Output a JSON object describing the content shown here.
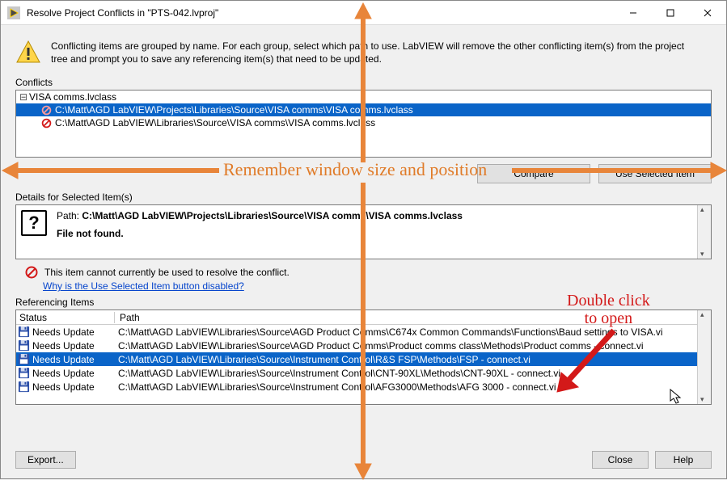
{
  "window": {
    "title": "Resolve Project Conflicts in \"PTS-042.lvproj\""
  },
  "info_text": "Conflicting items are grouped by name.  For each group, select which path to use.  LabVIEW will remove the other conflicting item(s) from the project tree and prompt you to save any referencing item(s) that need to be updated.",
  "labels": {
    "conflicts": "Conflicts",
    "details": "Details for Selected Item(s)",
    "referencing": "Referencing Items",
    "status_col": "Status",
    "path_col": "Path"
  },
  "conflicts_tree": {
    "group": "VISA comms.lvclass",
    "items": [
      {
        "path": "C:\\Matt\\AGD LabVIEW\\Projects\\Libraries\\Source\\VISA comms\\VISA comms.lvclass",
        "selected": true
      },
      {
        "path": "C:\\Matt\\AGD LabVIEW\\Libraries\\Source\\VISA comms\\VISA comms.lvclass",
        "selected": false
      }
    ]
  },
  "buttons": {
    "compare": "Compare",
    "use_selected": "Use Selected Item",
    "export": "Export...",
    "close": "Close",
    "help": "Help"
  },
  "details": {
    "path_label": "Path:",
    "path_value": "C:\\Matt\\AGD LabVIEW\\Projects\\Libraries\\Source\\VISA comms\\VISA comms.lvclass",
    "status": "File not found.",
    "cannot_text": "This item cannot currently be used to resolve the conflict.",
    "link_text": "Why is the Use Selected Item button disabled?"
  },
  "referencing_items": [
    {
      "status": "Needs Update",
      "path": "C:\\Matt\\AGD LabVIEW\\Libraries\\Source\\AGD Product Comms\\C674x Common Commands\\Functions\\Baud settings to VISA.vi",
      "selected": false
    },
    {
      "status": "Needs Update",
      "path": "C:\\Matt\\AGD LabVIEW\\Libraries\\Source\\AGD Product Comms\\Product comms class\\Methods\\Product comms - connect.vi",
      "selected": false
    },
    {
      "status": "Needs Update",
      "path": "C:\\Matt\\AGD LabVIEW\\Libraries\\Source\\Instrument Control\\R&S FSP\\Methods\\FSP - connect.vi",
      "selected": true
    },
    {
      "status": "Needs Update",
      "path": "C:\\Matt\\AGD LabVIEW\\Libraries\\Source\\Instrument Control\\CNT-90XL\\Methods\\CNT-90XL - connect.vi",
      "selected": false
    },
    {
      "status": "Needs Update",
      "path": "C:\\Matt\\AGD LabVIEW\\Libraries\\Source\\Instrument Control\\AFG3000\\Methods\\AFG 3000 - connect.vi",
      "selected": false
    }
  ],
  "annotations": {
    "remember": "Remember window size and position",
    "double_click": "Double click\nto open"
  }
}
